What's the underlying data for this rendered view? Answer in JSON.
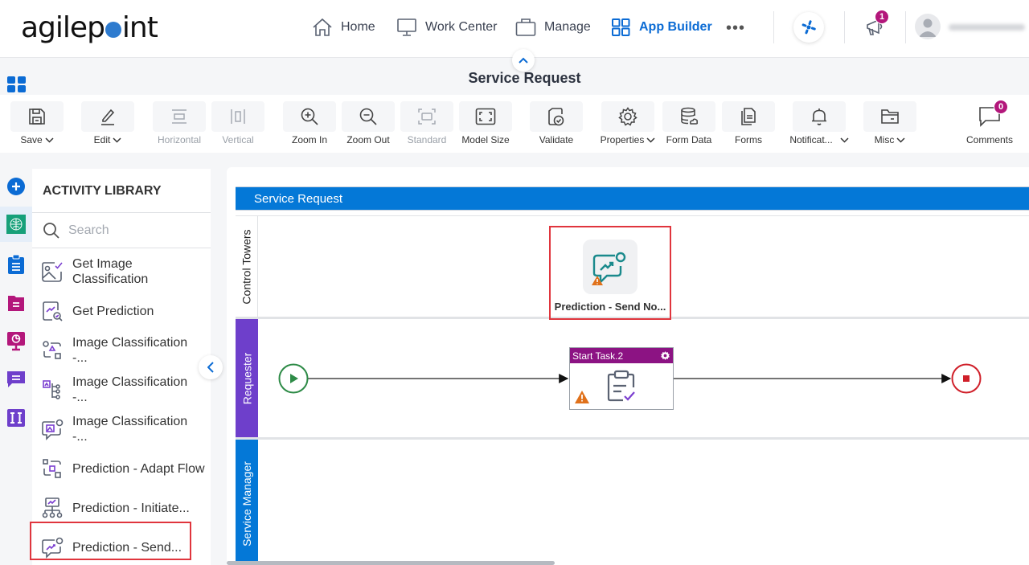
{
  "topbar": {
    "logo_left": "agilep",
    "logo_right": "int",
    "nav": [
      {
        "label": "Home",
        "icon": "home-icon"
      },
      {
        "label": "Work Center",
        "icon": "monitor-icon"
      },
      {
        "label": "Manage",
        "icon": "briefcase-icon"
      },
      {
        "label": "App Builder",
        "icon": "grid-icon",
        "active": true
      }
    ],
    "more_label": "•••",
    "notification_count": "1"
  },
  "title_bar": {
    "title": "Service Request"
  },
  "toolbar": {
    "buttons": [
      {
        "label": "Save",
        "dropdown": true,
        "icon": "save-icon"
      },
      {
        "label": "Edit",
        "dropdown": true,
        "icon": "pencil-icon"
      },
      {
        "label": "Horizontal",
        "disabled": true,
        "icon": "horizontal-align-icon"
      },
      {
        "label": "Vertical",
        "disabled": true,
        "icon": "vertical-align-icon"
      },
      {
        "label": "Zoom In",
        "icon": "zoom-in-icon"
      },
      {
        "label": "Zoom Out",
        "icon": "zoom-out-icon"
      },
      {
        "label": "Standard",
        "disabled": true,
        "icon": "standard-size-icon"
      },
      {
        "label": "Model Size",
        "icon": "fit-screen-icon"
      },
      {
        "label": "Validate",
        "icon": "validate-icon"
      },
      {
        "label": "Properties",
        "dropdown": true,
        "icon": "gear-icon"
      },
      {
        "label": "Form Data",
        "icon": "database-icon"
      },
      {
        "label": "Forms",
        "icon": "forms-icon"
      },
      {
        "label": "Notificat...",
        "dropdown": true,
        "icon": "bell-icon"
      },
      {
        "label": "Misc",
        "dropdown": true,
        "icon": "folder-icon"
      },
      {
        "label": "Comments",
        "icon": "comment-icon"
      }
    ],
    "comments_count": "0"
  },
  "library": {
    "title": "ACTIVITY LIBRARY",
    "search_placeholder": "Search",
    "items": [
      {
        "label": "Get Image Classification",
        "icon": "image-check-icon"
      },
      {
        "label": "Get Prediction",
        "icon": "prediction-search-icon"
      },
      {
        "label": "Image Classification -...",
        "icon": "image-classification-flow-icon"
      },
      {
        "label": "Image Classification -...",
        "icon": "image-classification-tree-icon"
      },
      {
        "label": "Image Classification -...",
        "icon": "image-classification-chat-icon"
      },
      {
        "label": "Prediction - Adapt Flow",
        "icon": "adapt-flow-icon"
      },
      {
        "label": "Prediction - Initiate...",
        "icon": "initiate-process-icon"
      },
      {
        "label": "Prediction - Send...",
        "icon": "send-notification-icon",
        "highlighted": true
      }
    ]
  },
  "canvas": {
    "pool_name": "Service Request",
    "lanes": [
      {
        "name": "Control Towers"
      },
      {
        "name": "Requester"
      },
      {
        "name": "Service Manager"
      }
    ],
    "shape_prediction_label": "Prediction - Send No...",
    "task_label": "Start Task.2"
  },
  "colors": {
    "accent_blue": "#0478d7",
    "task_header": "#8c1383",
    "lane_requester": "#6e3fcb",
    "warning": "#e0711b",
    "start_event": "#2e8b47",
    "end_event": "#d0202a",
    "highlight": "#e0353d",
    "badge": "#b3177b"
  }
}
